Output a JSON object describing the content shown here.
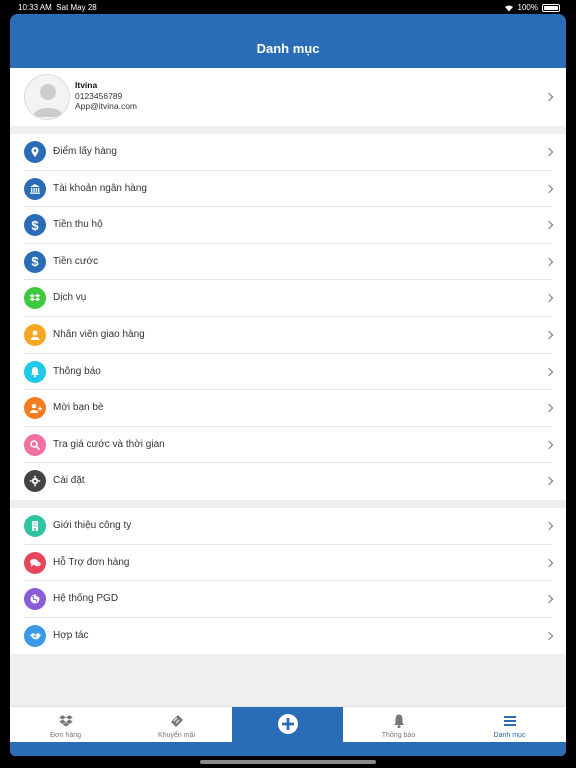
{
  "status": {
    "time": "10:33 AM",
    "date": "Sat May 28",
    "battery": "100%"
  },
  "header": {
    "title": "Danh mục"
  },
  "profile": {
    "name": "Itvina",
    "phone": "0123456789",
    "email": "App@itvina.com"
  },
  "sections": [
    {
      "items": [
        {
          "label": "Điểm lấy hàng",
          "icon": "location-pin-icon",
          "color": "#2b6cb7"
        },
        {
          "label": "Tài khoản ngân hàng",
          "icon": "bank-icon",
          "color": "#2b6cb7"
        },
        {
          "label": "Tiền thu hộ",
          "icon": "dollar-icon",
          "color": "#2b6cb7"
        },
        {
          "label": "Tiền cước",
          "icon": "dollar-icon",
          "color": "#2b6cb7"
        },
        {
          "label": "Dịch vụ",
          "icon": "dropbox-icon",
          "color": "#3dc93d"
        },
        {
          "label": "Nhân viên giao hàng",
          "icon": "user-icon",
          "color": "#f5a623"
        },
        {
          "label": "Thông báo",
          "icon": "bell-icon",
          "color": "#1ec8e6"
        },
        {
          "label": "Mời bạn bè",
          "icon": "user-plus-icon",
          "color": "#f57c1f"
        },
        {
          "label": "Tra giá cước và thời gian",
          "icon": "search-icon",
          "color": "#f070a0"
        },
        {
          "label": "Cài đặt",
          "icon": "gear-icon",
          "color": "#444444"
        }
      ]
    },
    {
      "items": [
        {
          "label": "Giới thiệu công ty",
          "icon": "building-icon",
          "color": "#2ec4a0"
        },
        {
          "label": "Hỗ Trợ đơn hàng",
          "icon": "chat-icon",
          "color": "#e8455f"
        },
        {
          "label": "Hệ thống PGD",
          "icon": "globe-icon",
          "color": "#8a5cd8"
        },
        {
          "label": "Hợp tác",
          "icon": "handshake-icon",
          "color": "#3a9ae8"
        }
      ]
    }
  ],
  "tabs": [
    {
      "label": "Đơn hàng",
      "icon": "dropbox-icon"
    },
    {
      "label": "Khuyến mãi",
      "icon": "ticket-icon"
    },
    {
      "label": "",
      "icon": "plus-circle-icon"
    },
    {
      "label": "Thông báo",
      "icon": "bell-icon"
    },
    {
      "label": "Danh mục",
      "icon": "menu-icon"
    }
  ],
  "colors": {
    "primary": "#2b6cb7",
    "background": "#efefef"
  }
}
